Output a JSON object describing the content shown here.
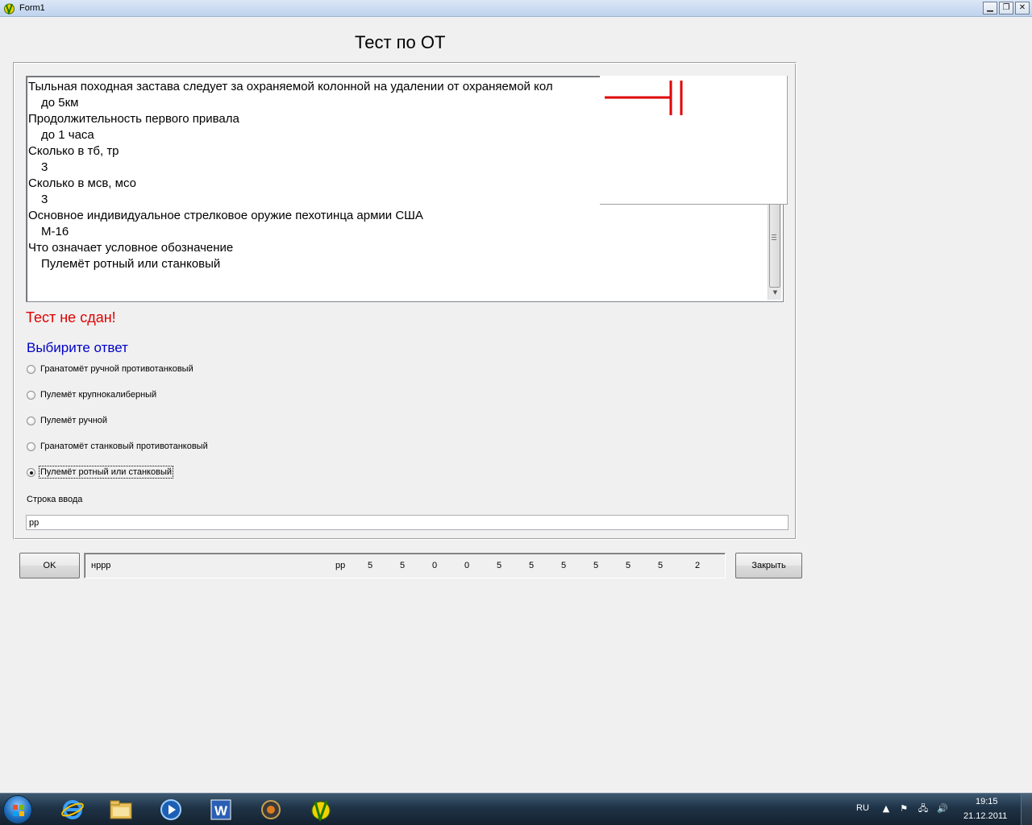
{
  "window": {
    "title": "Form1",
    "minimize_glyph": "▁",
    "restore_glyph": "❐",
    "close_glyph": "✕"
  },
  "form": {
    "heading": "Тест по ОТ",
    "log_lines": [
      {
        "text": "Тыльная походная застава следует за охраняемой колонной на удалении от охраняемой кол",
        "kind": "question"
      },
      {
        "text": "до 5км",
        "kind": "answer"
      },
      {
        "text": "Продолжительность первого привала",
        "kind": "question"
      },
      {
        "text": "до 1 часа",
        "kind": "answer"
      },
      {
        "text": "Сколько в тб, тр",
        "kind": "question"
      },
      {
        "text": "3",
        "kind": "answer"
      },
      {
        "text": "Сколько в мсв, мсо",
        "kind": "question"
      },
      {
        "text": "3",
        "kind": "answer"
      },
      {
        "text": "Основное индивидуальное стрелковое оружие пехотинца армии США",
        "kind": "question"
      },
      {
        "text": "М-16",
        "kind": "answer"
      },
      {
        "text": "Что означает условное обозначение",
        "kind": "question"
      },
      {
        "text": "Пулемёт ротный или станковый",
        "kind": "answer"
      }
    ],
    "symbol_color": "#e00000",
    "result_text": "Тест не сдан!",
    "result_color": "#e00000",
    "prompt_text": "Выбирите ответ",
    "prompt_color": "#0000c8",
    "options": [
      {
        "label": "Гранатомёт ручной противотанковый",
        "checked": false
      },
      {
        "label": "Пулемёт крупнокалиберный",
        "checked": false
      },
      {
        "label": "Пулемёт ручной",
        "checked": false
      },
      {
        "label": "Гранатомёт станковый противотанковый",
        "checked": false
      },
      {
        "label": "Пулемёт ротный или станковый",
        "checked": true
      }
    ],
    "input_label": "Строка ввода",
    "input_value": "рр",
    "ok_label": "OK",
    "close_label": "Закрыть",
    "status": {
      "text1": "нррр",
      "text2": "рр",
      "scores": [
        "5",
        "5",
        "0",
        "0",
        "5",
        "5",
        "5",
        "5",
        "5",
        "5"
      ],
      "final": "2"
    }
  },
  "taskbar": {
    "items": [
      {
        "name": "internet-explorer",
        "state": "pinned"
      },
      {
        "name": "windows-explorer",
        "state": "open"
      },
      {
        "name": "media-player",
        "state": "pinned"
      },
      {
        "name": "microsoft-word",
        "state": "open"
      },
      {
        "name": "media-center",
        "state": "open"
      },
      {
        "name": "form1-app",
        "state": "active"
      }
    ],
    "language": "RU",
    "time": "19:15",
    "date": "21.12.2011"
  }
}
